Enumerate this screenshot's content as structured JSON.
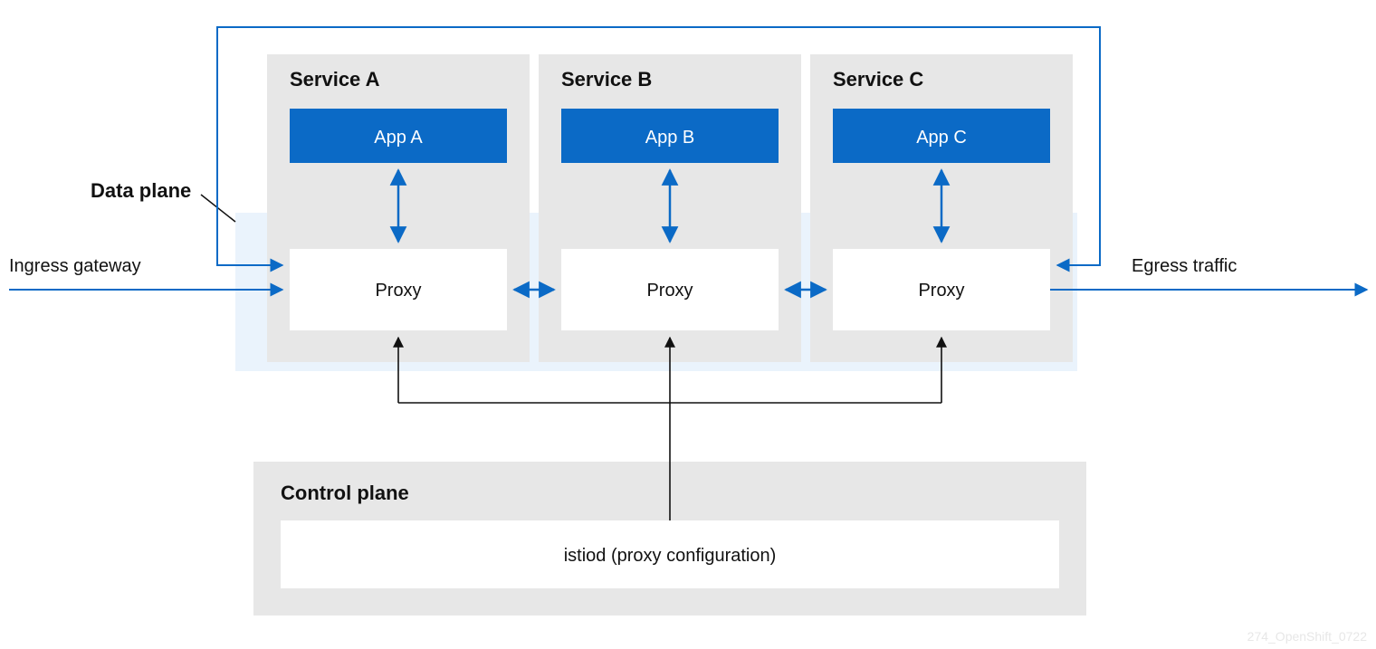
{
  "labels": {
    "data_plane": "Data plane",
    "ingress": "Ingress gateway",
    "egress": "Egress traffic",
    "control_plane_title": "Control plane",
    "istiod": "istiod (proxy configuration)",
    "watermark": "274_OpenShift_0722"
  },
  "services": [
    {
      "title": "Service A",
      "app": "App A",
      "proxy": "Proxy"
    },
    {
      "title": "Service B",
      "app": "App B",
      "proxy": "Proxy"
    },
    {
      "title": "Service C",
      "app": "App C",
      "proxy": "Proxy"
    }
  ],
  "colors": {
    "panel_grey": "#e7e7e7",
    "data_plane_fill": "#e3effb",
    "app_blue": "#0b6ac6",
    "arrow_blue": "#0b6ac6",
    "arrow_black": "#111111",
    "white": "#ffffff"
  }
}
